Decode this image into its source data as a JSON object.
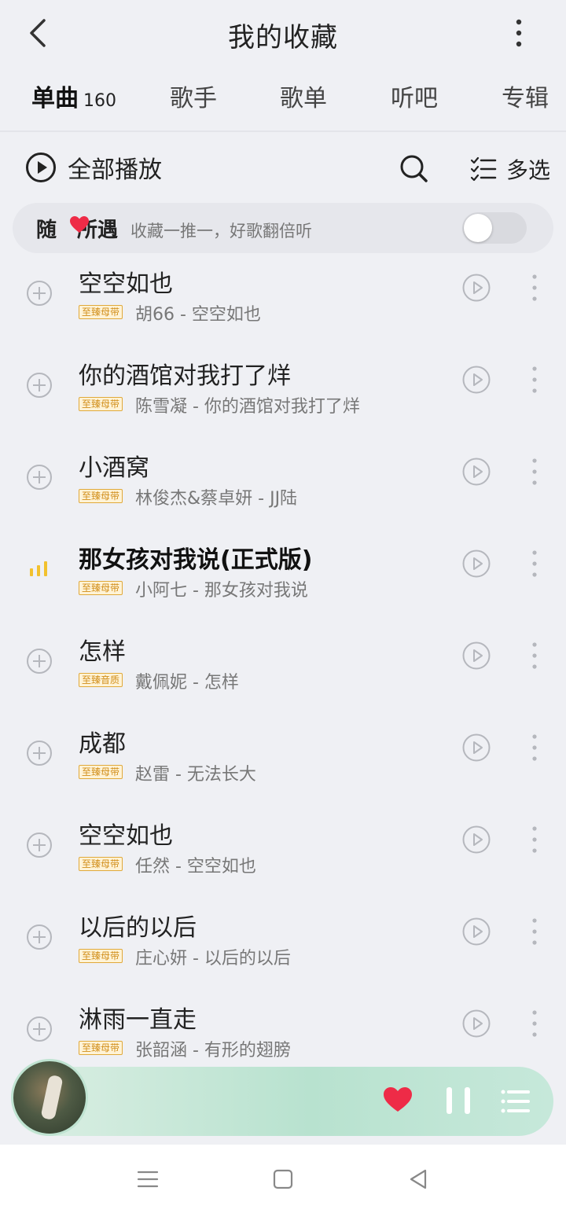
{
  "header": {
    "title": "我的收藏",
    "back_icon": "chevron-left-icon",
    "more_icon": "more-vertical-icon"
  },
  "tabs": [
    {
      "label": "单曲",
      "count": "160",
      "active": true
    },
    {
      "label": "歌手"
    },
    {
      "label": "歌单"
    },
    {
      "label": "听吧"
    },
    {
      "label": "专辑"
    }
  ],
  "toolbar": {
    "play_all_label": "全部播放",
    "multi_select_label": "多选"
  },
  "random": {
    "title_prefix": "随",
    "title_suffix": "所遇",
    "subtitle": "收藏一推一，好歌翻倍听",
    "enabled": false
  },
  "songs": [
    {
      "title": "空空如也",
      "badge": "至臻母带",
      "meta": "胡66 - 空空如也",
      "playing": false
    },
    {
      "title": "你的酒馆对我打了烊",
      "badge": "至臻母带",
      "meta": "陈雪凝 - 你的酒馆对我打了烊",
      "playing": false
    },
    {
      "title": "小酒窝",
      "badge": "至臻母带",
      "meta": "林俊杰&蔡卓妍 - JJ陆",
      "playing": false
    },
    {
      "title": "那女孩对我说(正式版)",
      "badge": "至臻母带",
      "meta": "小阿七 - 那女孩对我说",
      "playing": true
    },
    {
      "title": "怎样",
      "badge": "至臻音质",
      "meta": "戴佩妮 - 怎样",
      "playing": false
    },
    {
      "title": "成都",
      "badge": "至臻母带",
      "meta": "赵雷 - 无法长大",
      "playing": false
    },
    {
      "title": "空空如也",
      "badge": "至臻母带",
      "meta": "任然 - 空空如也",
      "playing": false
    },
    {
      "title": "以后的以后",
      "badge": "至臻母带",
      "meta": "庄心妍 - 以后的以后",
      "playing": false
    },
    {
      "title": "淋雨一直走",
      "badge": "至臻母带",
      "meta": "张韶涵 - 有形的翅膀",
      "playing": false
    }
  ],
  "colors": {
    "accent_yellow": "#ffd84a",
    "heart_red": "#ee2b47",
    "badge_orange": "#d18f1c",
    "player_green": "#b8e2cf"
  }
}
